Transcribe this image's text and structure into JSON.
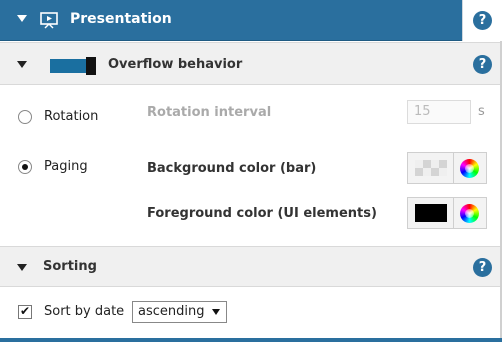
{
  "header": {
    "title": "Presentation",
    "collapse_icon": "caret-down-icon",
    "section_icon": "presentation-icon",
    "help_text": "?",
    "background_color": "#2a6f9e"
  },
  "overflow": {
    "title": "Overflow behavior",
    "help_text": "?",
    "options": [
      {
        "label": "Rotation",
        "checked": false
      },
      {
        "label": "Paging",
        "checked": true
      }
    ],
    "rotation_interval": {
      "label": "Rotation interval",
      "value": "15",
      "unit": "s",
      "disabled": true
    },
    "background_color": {
      "label": "Background color (bar)",
      "value": "transparent"
    },
    "foreground_color": {
      "label": "Foreground color (UI elements)",
      "value": "#000000"
    }
  },
  "sorting": {
    "title": "Sorting",
    "help_text": "?",
    "sort_by_date": {
      "label": "Sort by date",
      "checked": true
    },
    "order": {
      "value": "ascending",
      "options": [
        "ascending"
      ]
    }
  }
}
